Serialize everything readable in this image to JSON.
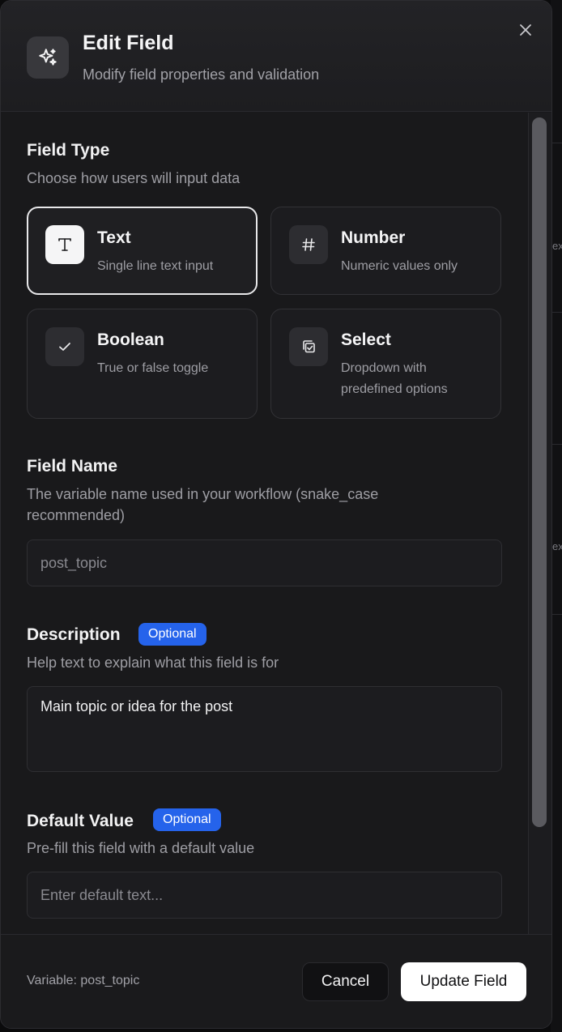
{
  "dialog": {
    "title": "Edit Field",
    "subtitle": "Modify field properties and validation",
    "header_icon": "sparkles-icon",
    "close_icon": "close-icon"
  },
  "field_type": {
    "label": "Field Type",
    "hint": "Choose how users will input data",
    "selected": "Text",
    "options": [
      {
        "name": "Text",
        "description": "Single line text input",
        "icon": "text-type-icon"
      },
      {
        "name": "Number",
        "description": "Numeric values only",
        "icon": "hash-icon"
      },
      {
        "name": "Boolean",
        "description": "True or false toggle",
        "icon": "check-icon"
      },
      {
        "name": "Select",
        "description": "Dropdown with predefined options",
        "icon": "select-icon"
      }
    ]
  },
  "field_name": {
    "label": "Field Name",
    "hint": "The variable name used in your workflow (snake_case recommended)",
    "value": "post_topic"
  },
  "description": {
    "label": "Description",
    "badge": "Optional",
    "hint": "Help text to explain what this field is for",
    "value": "Main topic or idea for the post"
  },
  "default_value": {
    "label": "Default Value",
    "badge": "Optional",
    "hint": "Pre-fill this field with a default value",
    "placeholder": "Enter default text..."
  },
  "footer": {
    "variable_text": "Variable: post_topic",
    "cancel_label": "Cancel",
    "update_label": "Update Field"
  },
  "background": {
    "edge_text_1": "ex",
    "edge_text_2": "ex"
  },
  "colors": {
    "accent": "#2563eb",
    "surface": "#19191b",
    "primary_button": "#ffffff"
  }
}
